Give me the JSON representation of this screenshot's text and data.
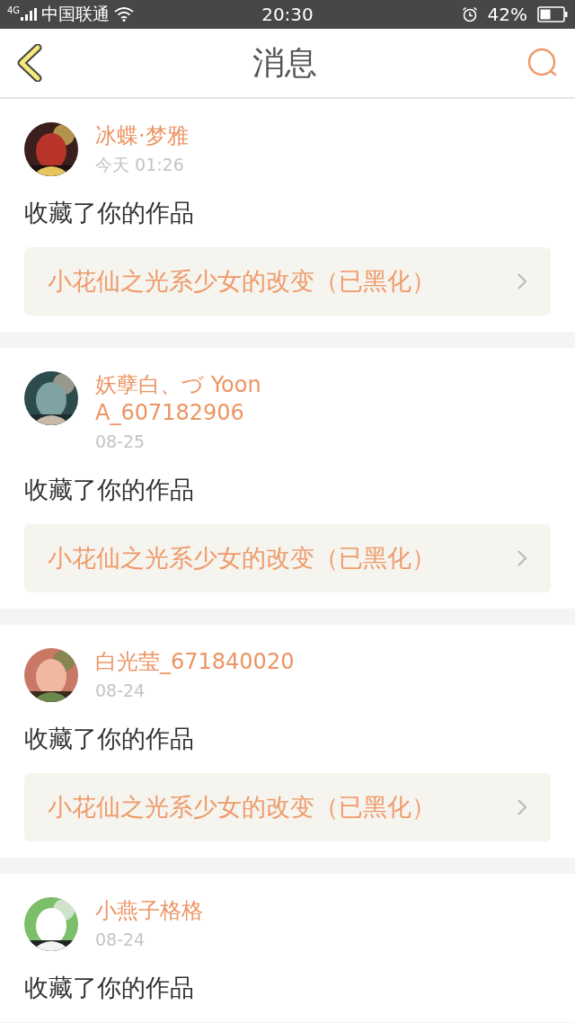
{
  "status_bar": {
    "network": "4G",
    "carrier": "中国联通",
    "time": "20:30",
    "battery": "42%"
  },
  "header": {
    "title": "消息"
  },
  "messages": [
    {
      "name": "冰蝶·梦雅",
      "time": "今天 01:26",
      "action": "收藏了你的作品",
      "work": "小花仙之光系少女的改变（已黑化）"
    },
    {
      "name": "妖孽白、づ Yoon\nA_607182906",
      "time": "08-25",
      "action": "收藏了你的作品",
      "work": "小花仙之光系少女的改变（已黑化）"
    },
    {
      "name": "白光莹_671840020",
      "time": "08-24",
      "action": "收藏了你的作品",
      "work": "小花仙之光系少女的改变（已黑化）"
    },
    {
      "name": "小燕子格格",
      "time": "08-24",
      "action": "收藏了你的作品"
    }
  ]
}
